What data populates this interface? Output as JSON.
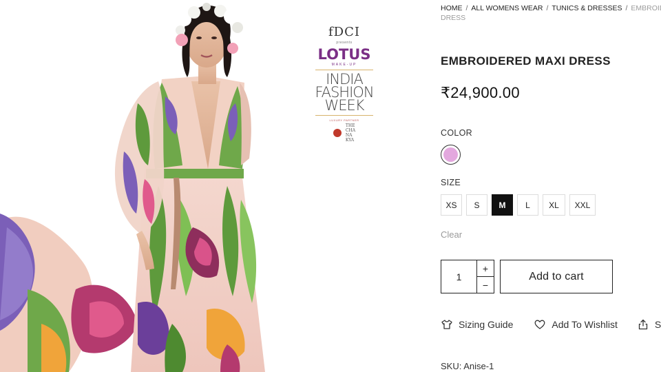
{
  "breadcrumb": {
    "items": [
      "HOME",
      "ALL WOMENS WEAR",
      "TUNICS & DRESSES"
    ],
    "separator": "/",
    "current_line1": "EMBROIDERED",
    "current_line2": "DRESS"
  },
  "product": {
    "title": "EMBROIDERED MAXI DRESS",
    "price": "₹24,900.00"
  },
  "color": {
    "label": "COLOR",
    "swatch_hex": "#e3a8de"
  },
  "size": {
    "label": "SIZE",
    "options": [
      "XS",
      "S",
      "M",
      "L",
      "XL",
      "XXL"
    ],
    "selected": "M",
    "clear_label": "Clear"
  },
  "cart": {
    "quantity": "1",
    "plus": "+",
    "minus": "−",
    "add_label": "Add to cart"
  },
  "actions": {
    "sizing_guide": "Sizing Guide",
    "wishlist": "Add To Wishlist",
    "share_partial": "S"
  },
  "sku": {
    "label": "SKU:",
    "value": "Anise-1"
  },
  "image_logo": {
    "fdci": "fDCI",
    "presents": "presents",
    "lotus": "LOTUS",
    "lotus_sub": "MAKE-UP",
    "india": "INDIA",
    "fashion": "FASHION",
    "week": "WEEK",
    "partner_caption": "LUXURY PARTNER",
    "partner_name_1": "THE",
    "partner_name_2": "CHA",
    "partner_name_3": "NA",
    "partner_name_4": "KYA"
  },
  "icons": {
    "sizing": "tshirt-icon",
    "wishlist": "heart-icon",
    "share": "share-icon"
  },
  "colors": {
    "selected_size_bg": "#111111",
    "muted_text": "#9a9a9a",
    "dress_pink": "#f2cfc8",
    "leaf_green": "#6fa84a",
    "iris_purple": "#7b5fb8",
    "lotus_purple": "#7b2f86"
  }
}
